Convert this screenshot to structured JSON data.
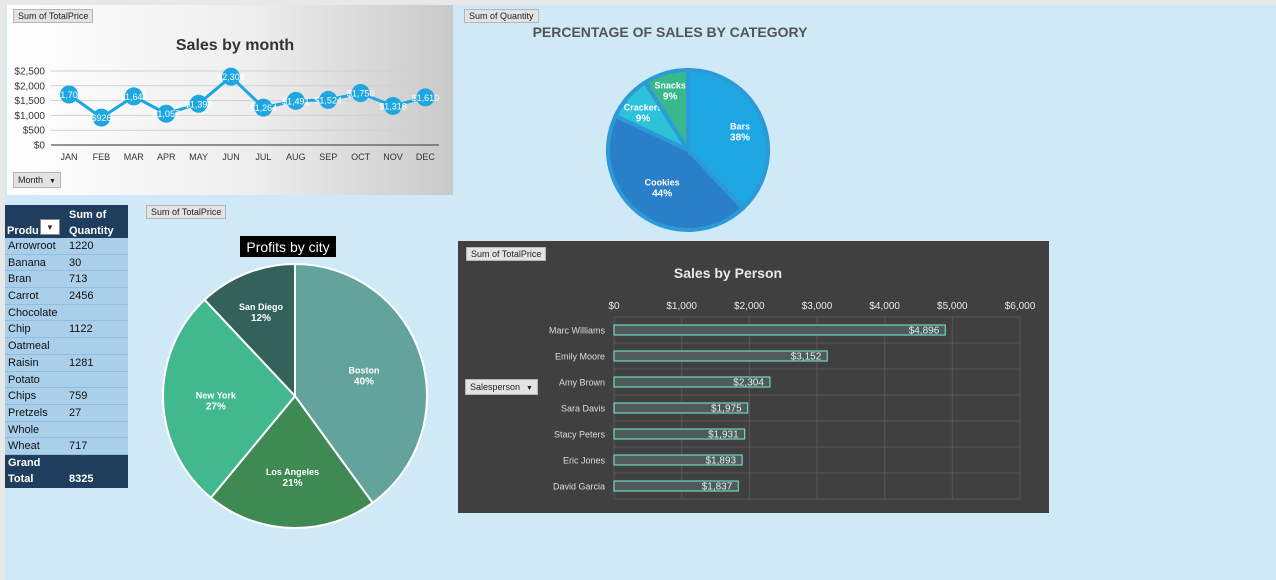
{
  "sales_by_month": {
    "field_button": "Sum of TotalPrice",
    "filter_button": "Month",
    "chart_data": {
      "type": "line",
      "title": "Sales by month",
      "categories": [
        "JAN",
        "FEB",
        "MAR",
        "APR",
        "MAY",
        "JUN",
        "JUL",
        "AUG",
        "SEP",
        "OCT",
        "NOV",
        "DEC"
      ],
      "values": [
        1706,
        926,
        1641,
        1057,
        1393,
        2308,
        1264,
        1491,
        1524,
        1756,
        1318,
        1610
      ],
      "value_labels": [
        "$1,706",
        "$926",
        "$1,641",
        "$1,057",
        "$1,393",
        "$2,308",
        "$1,264",
        "$1,491",
        "$1,524",
        "$1,756",
        "$1,318",
        "$1,610"
      ],
      "y_ticks": [
        "$0",
        "$500",
        "$1,000",
        "$1,500",
        "$2,000",
        "$2,500"
      ],
      "ylim": [
        0,
        2500
      ],
      "series_color": "#1ea6e3"
    }
  },
  "category_chart": {
    "field_button": "Sum of Quantity",
    "chart_data": {
      "type": "pie",
      "title": "PERCENTAGE OF SALES BY CATEGORY",
      "slices": [
        {
          "label": "Bars",
          "percent": 38,
          "pct_label": "38%",
          "color": "#1ea6e3"
        },
        {
          "label": "Cookies",
          "percent": 44,
          "pct_label": "44%",
          "color": "#2a7fc9"
        },
        {
          "label": "Crackers",
          "percent": 9,
          "pct_label": "9%",
          "color": "#2cc3da"
        },
        {
          "label": "Snacks",
          "percent": 9,
          "pct_label": "9%",
          "color": "#38b98d"
        }
      ]
    }
  },
  "pivot": {
    "header_col1": "Produ",
    "header_col2": "Sum of Quantity",
    "rows": [
      {
        "product": "Arrowroot",
        "qty": "1220"
      },
      {
        "product": "Banana",
        "qty": "30"
      },
      {
        "product": "Bran",
        "qty": "713"
      },
      {
        "product": "Carrot",
        "qty": "2456"
      },
      {
        "product": "Chocolate",
        "qty": ""
      },
      {
        "product": "Chip",
        "qty": "1122"
      },
      {
        "product": "Oatmeal",
        "qty": ""
      },
      {
        "product": "Raisin",
        "qty": "1281"
      },
      {
        "product": "Potato",
        "qty": ""
      },
      {
        "product": "Chips",
        "qty": "759"
      },
      {
        "product": "Pretzels",
        "qty": "27"
      },
      {
        "product": "Whole",
        "qty": ""
      },
      {
        "product": "Wheat",
        "qty": "717"
      }
    ],
    "total_label_1": "Grand",
    "total_label_2": "Total",
    "total_value": "8325"
  },
  "profits_by_city": {
    "field_button": "Sum of TotalPrice",
    "chart_data": {
      "type": "pie",
      "title": "Profits by city",
      "slices": [
        {
          "label": "Boston",
          "percent": 40,
          "pct_label": "40%",
          "color": "#62a39b"
        },
        {
          "label": "Los Angeles",
          "percent": 21,
          "pct_label": "21%",
          "color": "#3e8a52"
        },
        {
          "label": "New York",
          "percent": 27,
          "pct_label": "27%",
          "color": "#41b88d"
        },
        {
          "label": "San Diego",
          "percent": 12,
          "pct_label": "12%",
          "color": "#34625b"
        }
      ]
    }
  },
  "sales_by_person": {
    "field_button": "Sum of TotalPrice",
    "filter_button": "Salesperson",
    "chart_data": {
      "type": "bar",
      "orientation": "horizontal",
      "title": "Sales by Person",
      "categories": [
        "Marc Williams",
        "Emily Moore",
        "Amy Brown",
        "Sara Davis",
        "Stacy Peters",
        "Eric Jones",
        "David Garcia"
      ],
      "values": [
        4896,
        3152,
        2304,
        1975,
        1931,
        1893,
        1837
      ],
      "value_labels": [
        "$4,896",
        "$3,152",
        "$2,304",
        "$1,975",
        "$1,931",
        "$1,893",
        "$1,837"
      ],
      "x_ticks": [
        "$0",
        "$1,000",
        "$2,000",
        "$3,000",
        "$4,000",
        "$5,000",
        "$6,000"
      ],
      "xlim": [
        0,
        6000
      ],
      "bar_color": "#6fd6c8"
    }
  }
}
